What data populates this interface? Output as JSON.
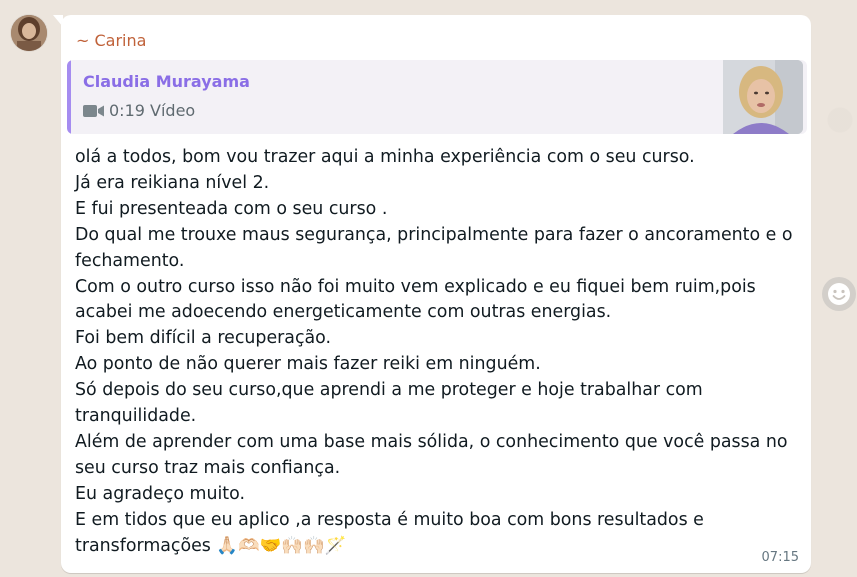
{
  "sender_name": "~ Carina",
  "quoted": {
    "author": "Claudia Murayama",
    "media_icon": "video-icon",
    "media_label": "0:19 Vídeo"
  },
  "message_lines": [
    "olá a todos, bom vou trazer aqui a minha experiência com o seu curso.",
    "Já era reikiana nível 2.",
    "E fui presenteada com o seu curso  .",
    "Do qual me trouxe maus segurança, principalmente para fazer o ancoramento e o",
    "fechamento.",
    "Com o outro curso isso não foi muito vem explicado e eu fiquei bem ruim,pois",
    "acabei me adoecendo energeticamente com outras energias.",
    "Foi bem difícil a recuperação.",
    "Ao ponto de não querer mais fazer reiki em ninguém.",
    "Só depois do seu curso,que aprendi a me proteger e hoje trabalhar com",
    "tranquilidade.",
    "Além de aprender com uma base mais sólida, o conhecimento que você passa no",
    "seu curso traz mais confiança.",
    "Eu agradeço muito.",
    "E em tidos que eu aplico ,a resposta é muito boa com bons resultados e",
    "transformações 🙏🏻🫶🏻🤝🙌🏻🙌🏻🪄"
  ],
  "timestamp": "07:15",
  "colors": {
    "sender": "#c0623a",
    "quote_author": "#8a6ee6",
    "quote_bar": "#a58cf0"
  }
}
